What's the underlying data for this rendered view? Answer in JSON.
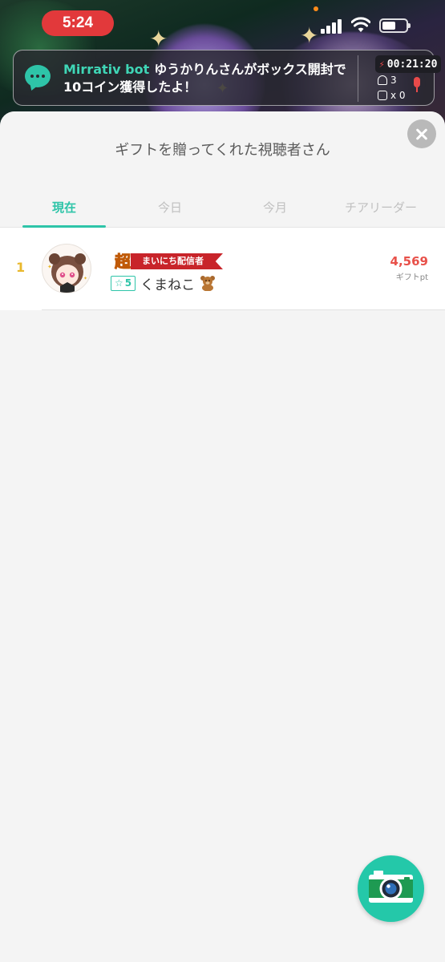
{
  "status_bar": {
    "time": "5:24"
  },
  "banner": {
    "sender": "Mirrativ bot",
    "message": "ゆうかりんさんがボックス開封で10コイン獲得したよ！",
    "timer": "00:21:20",
    "viewer_count": "3",
    "gift_count": "x 0"
  },
  "sheet": {
    "title": "ギフトを贈ってくれた視聴者さん",
    "tabs": [
      {
        "label": "現在",
        "active": true
      },
      {
        "label": "今日",
        "active": false
      },
      {
        "label": "今月",
        "active": false
      },
      {
        "label": "チアリーダー",
        "active": false
      }
    ],
    "rows": [
      {
        "rank": "1",
        "badge_super": "超",
        "badge_label": "まいにち配信者",
        "level": "5",
        "username": "くまねこ",
        "points": "4,569",
        "points_unit": "ギフトpt"
      }
    ]
  },
  "colors": {
    "accent": "#2ec4a8",
    "rank_gold": "#e9b82c",
    "points_red": "#e8514a",
    "ribbon_red": "#c8242a",
    "time_pill": "#e2393b"
  },
  "icons": {
    "chat": "chat-bubble-icon",
    "close": "close-icon",
    "camera": "camera-icon",
    "bear": "teddy-bear-icon",
    "viewers": "person-icon",
    "gift": "gift-icon",
    "mic": "microphone-icon"
  }
}
